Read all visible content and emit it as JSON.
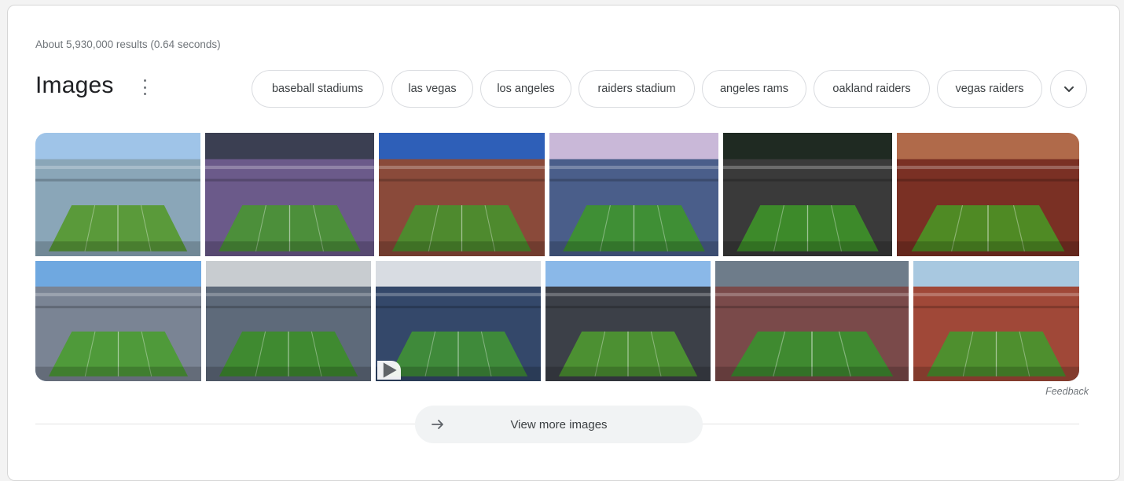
{
  "results": {
    "stats": "About 5,930,000 results (0.64 seconds)"
  },
  "images_header": {
    "title": "Images"
  },
  "chips": [
    {
      "label": "baseball stadiums"
    },
    {
      "label": "las vegas"
    },
    {
      "label": "los angeles"
    },
    {
      "label": "raiders stadium"
    },
    {
      "label": "angeles rams"
    },
    {
      "label": "oakland raiders"
    },
    {
      "label": "vegas raiders"
    }
  ],
  "grid": {
    "row1": [
      {
        "sky": "#9fc4e8",
        "field": "#5a9a3a",
        "stands": "#8aa6b8"
      },
      {
        "sky": "#3b3f52",
        "field": "#4c8f3a",
        "stands": "#6b5a8a"
      },
      {
        "sky": "#2e5fb8",
        "field": "#4e8a2e",
        "stands": "#8a4a3a"
      },
      {
        "sky": "#c9b8d8",
        "field": "#3f8f35",
        "stands": "#4a5e8a"
      },
      {
        "sky": "#1f2a22",
        "field": "#3d8a2a",
        "stands": "#3a3a3a"
      },
      {
        "sky": "#b06a4a",
        "field": "#4f8a24",
        "stands": "#7a3024"
      }
    ],
    "row2": [
      {
        "sky": "#6fa8e0",
        "field": "#4f9a3a",
        "stands": "#7a8494"
      },
      {
        "sky": "#c8ccd0",
        "field": "#3f8a30",
        "stands": "#5e6a7a"
      },
      {
        "sky": "#d8dce2",
        "field": "#3f8a3a",
        "stands": "#34486a"
      },
      {
        "sky": "#8ab8e8",
        "field": "#4c9032",
        "stands": "#3c4048"
      },
      {
        "sky": "#6e7c8a",
        "field": "#3f8a30",
        "stands": "#7a4a4a"
      },
      {
        "sky": "#a8c8e0",
        "field": "#4e8f2e",
        "stands": "#a04838"
      }
    ]
  },
  "feedback": {
    "label": "Feedback"
  },
  "view_more": {
    "label": "View more images"
  }
}
